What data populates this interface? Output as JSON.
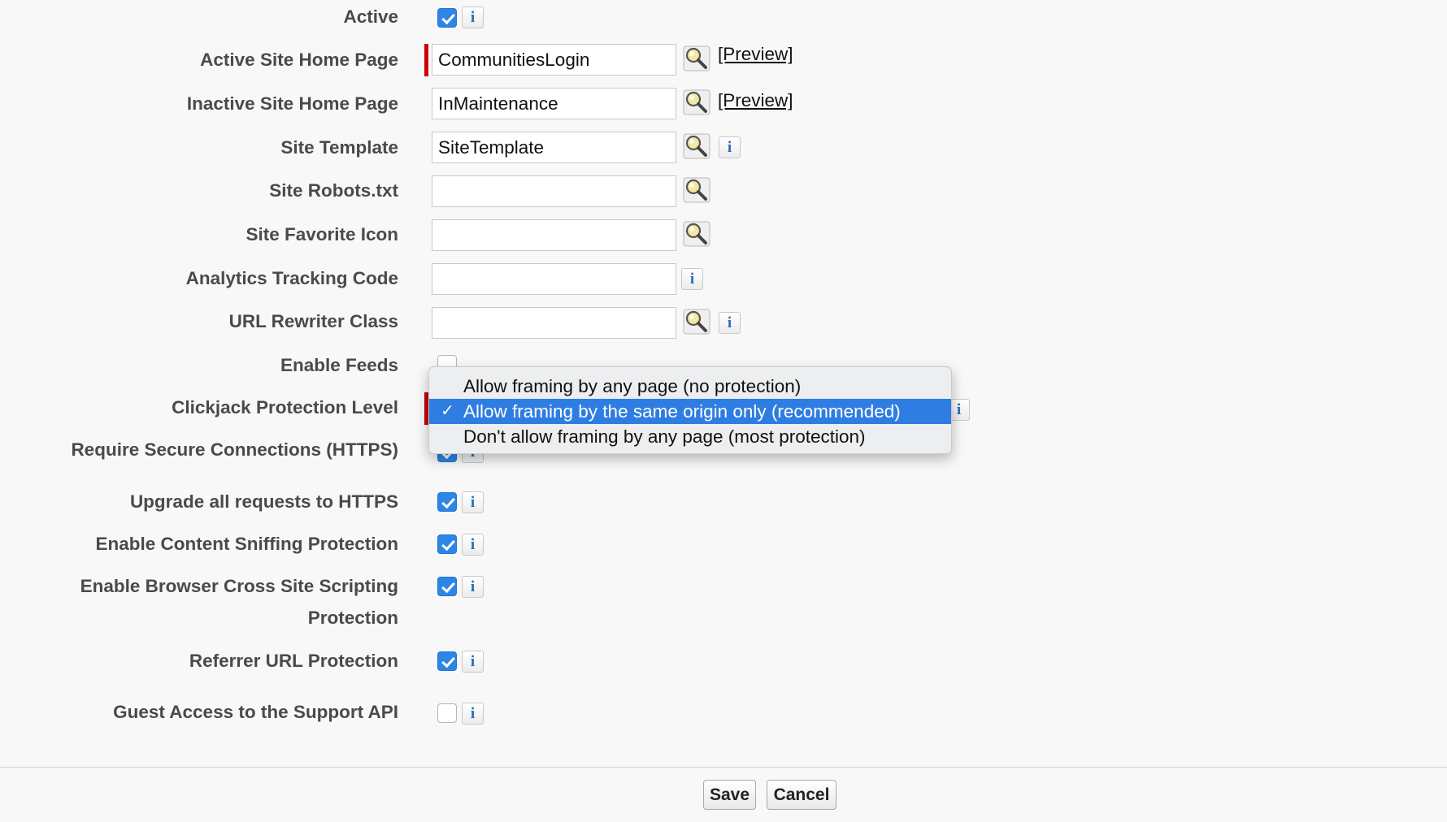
{
  "fields": {
    "active": {
      "label": "Active",
      "checked": true
    },
    "active_home": {
      "label": "Active Site Home Page",
      "value": "CommunitiesLogin",
      "preview": "[Preview]"
    },
    "inactive_home": {
      "label": "Inactive Site Home Page",
      "value": "InMaintenance",
      "preview": "[Preview]"
    },
    "site_template": {
      "label": "Site Template",
      "value": "SiteTemplate"
    },
    "robots": {
      "label": "Site Robots.txt",
      "value": ""
    },
    "favicon": {
      "label": "Site Favorite Icon",
      "value": ""
    },
    "analytics": {
      "label": "Analytics Tracking Code",
      "value": ""
    },
    "url_rewriter": {
      "label": "URL Rewriter Class",
      "value": ""
    },
    "enable_feeds": {
      "label": "Enable Feeds",
      "checked": false
    },
    "clickjack": {
      "label": "Clickjack Protection Level",
      "options": [
        "Allow framing by any page (no protection)",
        "Allow framing by the same origin only (recommended)",
        "Don't allow framing by any page (most protection)"
      ],
      "selected": "Allow framing by the same origin only (recommended)"
    },
    "https": {
      "label": "Require Secure Connections (HTTPS)",
      "checked": true
    },
    "upgrade_https": {
      "label": "Upgrade all requests to HTTPS",
      "checked": true
    },
    "sniffing": {
      "label": "Enable Content Sniffing Protection",
      "checked": true
    },
    "xss": {
      "label_line1": "Enable Browser Cross Site Scripting",
      "label_line2": "Protection",
      "checked": true
    },
    "referrer": {
      "label": "Referrer URL Protection",
      "checked": true
    },
    "guest_api": {
      "label": "Guest Access to the Support API",
      "checked": false
    }
  },
  "icons": {
    "info": "info-icon",
    "lookup": "magnifier-lookup-icon",
    "check": "checkmark-icon"
  },
  "info_glyph": "i",
  "check_glyph": "✓",
  "footer": {
    "save_label": "Save",
    "cancel_label": "Cancel"
  },
  "colors": {
    "accent": "#2d86e6",
    "required": "#cc0000",
    "selected_option": "#2e7de2"
  }
}
